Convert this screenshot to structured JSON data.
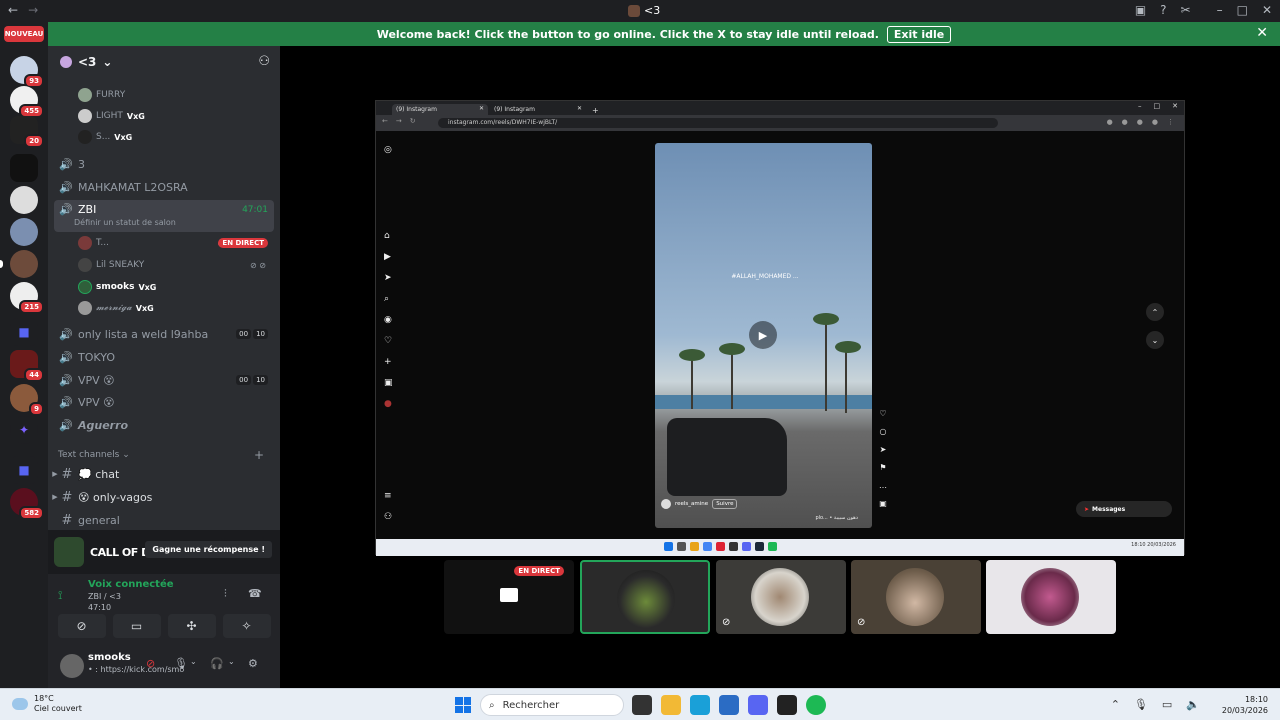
{
  "titlebar": {
    "title": "<3",
    "back_icon": "arrow-left-icon",
    "forward_icon": "arrow-right-icon"
  },
  "banner": {
    "message": "Welcome back! Click the button to go online. Click the X to stay idle until reload.",
    "button": "Exit idle",
    "close": "✕"
  },
  "servers": {
    "new_badge": "NOUVEAU",
    "badges": [
      "93",
      "455",
      "20",
      "215",
      "44",
      "9",
      "582"
    ]
  },
  "guild": {
    "name": "<3",
    "chevron": "⌄"
  },
  "voice_channels": [
    {
      "name": "FURRY",
      "type": "user"
    },
    {
      "name": "LIGHT",
      "type": "user",
      "tag": "VxG"
    },
    {
      "name": "S...",
      "type": "user",
      "tag": "VxG"
    },
    {
      "name": "3"
    },
    {
      "name": "MAHKAMAT L2OSRA"
    },
    {
      "name": "ZBI",
      "time": "47:01",
      "status": "Définir un statut de salon"
    },
    {
      "name": "T...",
      "type": "user",
      "live": "EN DIRECT"
    },
    {
      "name": "Lil SNEAKY",
      "type": "user"
    },
    {
      "name": "smooks",
      "type": "user",
      "tag": "VxG"
    },
    {
      "name": "𝓶𝓮𝓻𝓷𝓲𝓰𝓪",
      "type": "user",
      "tag": "VxG"
    },
    {
      "name": "only lista a weld l9ahba",
      "counts": [
        "00",
        "10"
      ]
    },
    {
      "name": "TOKYO"
    },
    {
      "name": "VPV 😵",
      "counts": [
        "00",
        "10"
      ]
    },
    {
      "name": "VPV 😵"
    },
    {
      "name": "𝘼𝙜𝙪𝙚𝙧𝙧𝙤"
    }
  ],
  "text_category": "Text channels",
  "text_channels": [
    {
      "name": "💭 chat"
    },
    {
      "name": "😵 only-vagos"
    },
    {
      "name": "general"
    }
  ],
  "promo": {
    "brand": "CALL OF DUTY",
    "button": "Gagne une récompense !"
  },
  "voice_panel": {
    "status": "Voix connectée",
    "channel": "ZBI / <3",
    "time": "47:10"
  },
  "user_panel": {
    "name": "smooks",
    "status": "• : https://kick.com/smo"
  },
  "stream": {
    "tab1": "(9) Instagram",
    "tab2": "(9) Instagram",
    "url": "instagram.com/reels/DWH7IE-wjBLT/",
    "caption": "#ALLAH_MOHAMED ...",
    "author": "reels_amine",
    "follow": "Suivre",
    "audio": "plo... • دهون سبيبة",
    "messages": "Messages",
    "time": "18:10",
    "date": "20/03/2026",
    "lang": "FRA\nFR"
  },
  "tiles": {
    "live": "EN DIRECT"
  },
  "taskbar": {
    "temp": "18°C",
    "weather": "Ciel couvert",
    "search": "Rechercher",
    "time": "18:10",
    "date": "20/03/2026"
  }
}
